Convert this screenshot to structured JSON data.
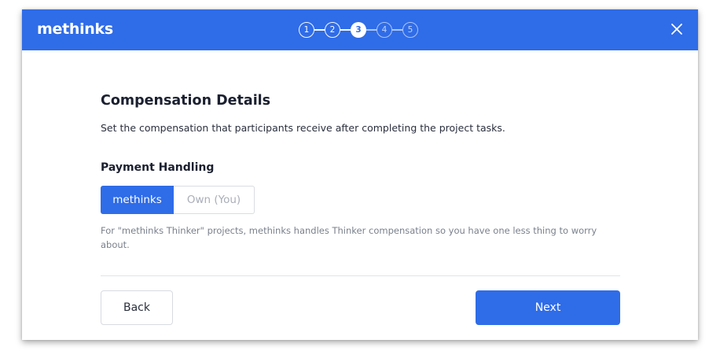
{
  "app": {
    "logo_text": "methinks"
  },
  "stepper": {
    "steps": [
      "1",
      "2",
      "3",
      "4",
      "5"
    ],
    "current_step": 3
  },
  "header": {
    "close_icon": "close-icon"
  },
  "content": {
    "title": "Compensation Details",
    "subtitle": "Set the compensation that participants receive after completing the project tasks.",
    "section_title": "Payment Handling",
    "toggle": {
      "options": [
        "methinks",
        "Own (You)"
      ],
      "selected": "methinks"
    },
    "note": "For \"methinks Thinker\" projects, methinks handles Thinker compensation so you have one less thing to worry about."
  },
  "footer": {
    "back_label": "Back",
    "next_label": "Next"
  },
  "colors": {
    "brand": "#2f6ce8",
    "muted_text": "#7a808c",
    "border": "#d9dce2"
  }
}
